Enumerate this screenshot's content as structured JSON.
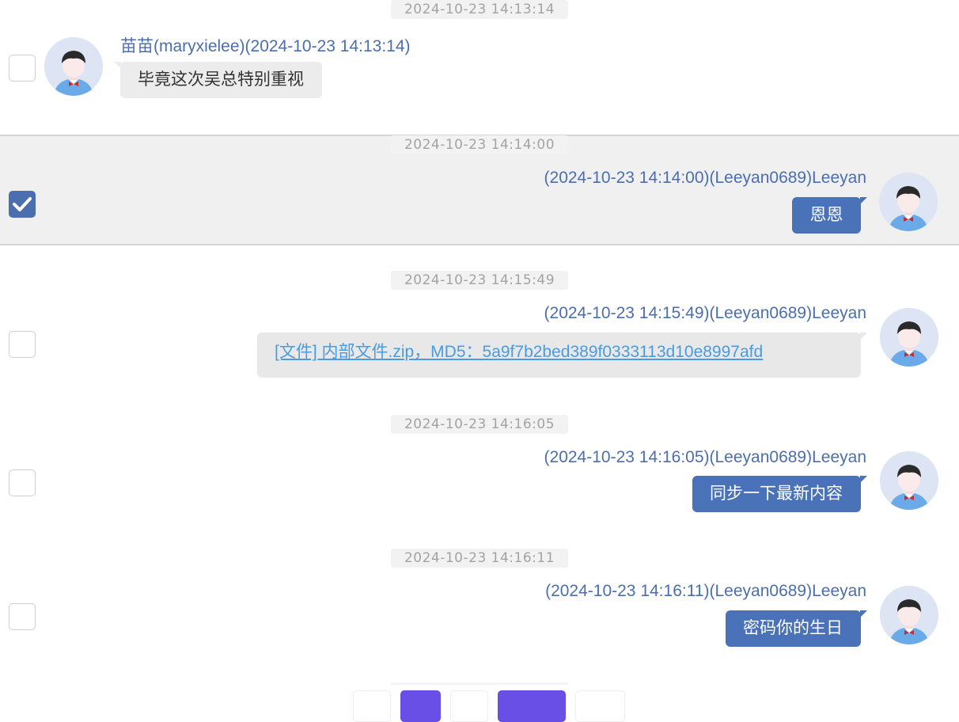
{
  "colors": {
    "accent": "#4a72b8",
    "name_text": "#4b6eaf",
    "link": "#4a9be0",
    "page_btn": "#6a4fe6"
  },
  "messages": [
    {
      "time": "2024-10-23 14:13:14",
      "side": "left",
      "sender": "苗苗(maryxielee)(2024-10-23 14:13:14)",
      "text": "毕竟这次吴总特别重视",
      "selected": false
    },
    {
      "time": "2024-10-23 14:14:00",
      "side": "right",
      "sender": "(2024-10-23 14:14:00)(Leeyan0689)Leeyan",
      "text": "恩恩",
      "selected": true
    },
    {
      "time": "2024-10-23 14:15:49",
      "side": "right",
      "sender": "(2024-10-23 14:15:49)(Leeyan0689)Leeyan",
      "text": "[文件] 内部文件.zip，MD5：5a9f7b2bed389f0333113d10e8997afd",
      "selected": false,
      "is_file": true
    },
    {
      "time": "2024-10-23 14:16:05",
      "side": "right",
      "sender": "(2024-10-23 14:16:05)(Leeyan0689)Leeyan",
      "text": "同步一下最新内容",
      "selected": false
    },
    {
      "time": "2024-10-23 14:16:11",
      "side": "right",
      "sender": "(2024-10-23 14:16:11)(Leeyan0689)Leeyan",
      "text": "密码你的生日",
      "selected": false
    }
  ]
}
